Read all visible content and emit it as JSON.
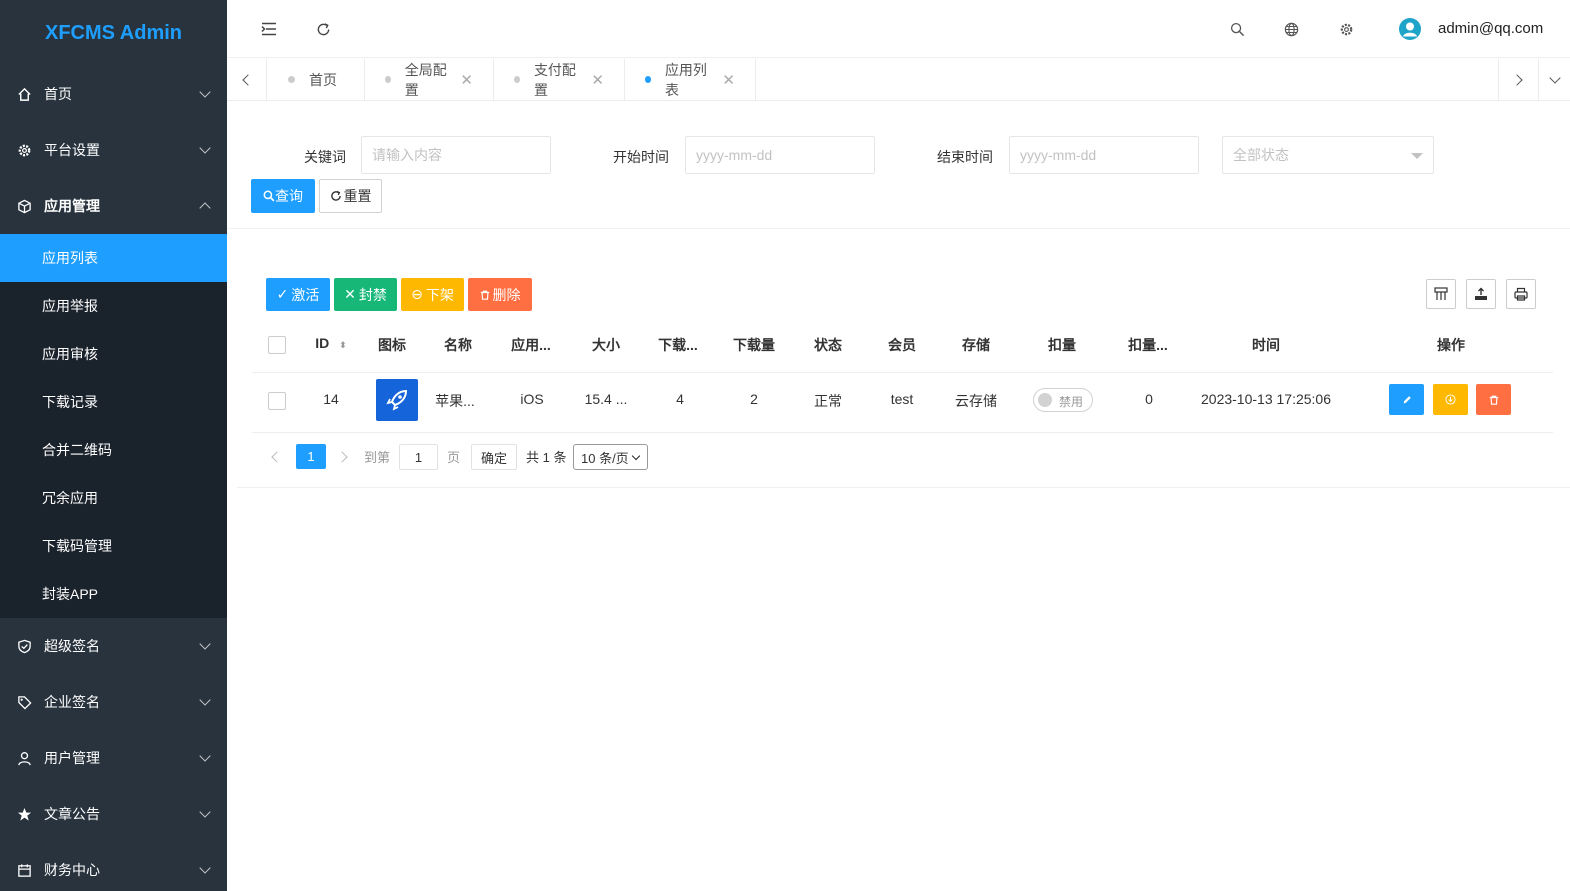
{
  "app": {
    "title": "XFCMS Admin"
  },
  "sidebar": {
    "items": [
      {
        "label": "首页"
      },
      {
        "label": "平台设置"
      },
      {
        "label": "应用管理"
      },
      {
        "label": "超级签名"
      },
      {
        "label": "企业签名"
      },
      {
        "label": "用户管理"
      },
      {
        "label": "文章公告"
      },
      {
        "label": "财务中心"
      }
    ],
    "submenu": [
      {
        "label": "应用列表"
      },
      {
        "label": "应用举报"
      },
      {
        "label": "应用审核"
      },
      {
        "label": "下载记录"
      },
      {
        "label": "合并二维码"
      },
      {
        "label": "冗余应用"
      },
      {
        "label": "下载码管理"
      },
      {
        "label": "封装APP"
      }
    ]
  },
  "header": {
    "user": "admin@qq.com"
  },
  "tabs": [
    {
      "label": "首页"
    },
    {
      "label": "全局配置"
    },
    {
      "label": "支付配置"
    },
    {
      "label": "应用列表"
    }
  ],
  "search": {
    "keyword_label": "关键词",
    "keyword_placeholder": "请输入内容",
    "start_label": "开始时间",
    "start_placeholder": "yyyy-mm-dd",
    "end_label": "结束时间",
    "end_placeholder": "yyyy-mm-dd",
    "status_placeholder": "全部状态",
    "query_label": "查询",
    "reset_label": "重置"
  },
  "toolbar": {
    "activate": "激活",
    "ban": "封禁",
    "offline": "下架",
    "delete": "删除"
  },
  "table": {
    "headers": [
      "ID",
      "图标",
      "名称",
      "应用...",
      "大小",
      "下载...",
      "下载量",
      "状态",
      "会员",
      "存储",
      "扣量",
      "扣量...",
      "时间",
      "操作"
    ],
    "row": {
      "id": "14",
      "name": "苹果...",
      "platform": "iOS",
      "size": "15.4 ...",
      "download_limit": "4",
      "downloads": "2",
      "status": "正常",
      "member": "test",
      "storage": "云存储",
      "switch_label": "禁用",
      "deduct_count": "0",
      "time": "2023-10-13 17:25:06"
    }
  },
  "pager": {
    "current": "1",
    "goto_label": "到第",
    "goto_value": "1",
    "page_label": "页",
    "ok_label": "确定",
    "total": "共 1 条",
    "per_page": "10 条/页"
  },
  "colors": {
    "primary": "#1e9fff",
    "green": "#16b777",
    "orange": "#ffb800",
    "red": "#ff5722",
    "sidebar": "#28333e"
  }
}
